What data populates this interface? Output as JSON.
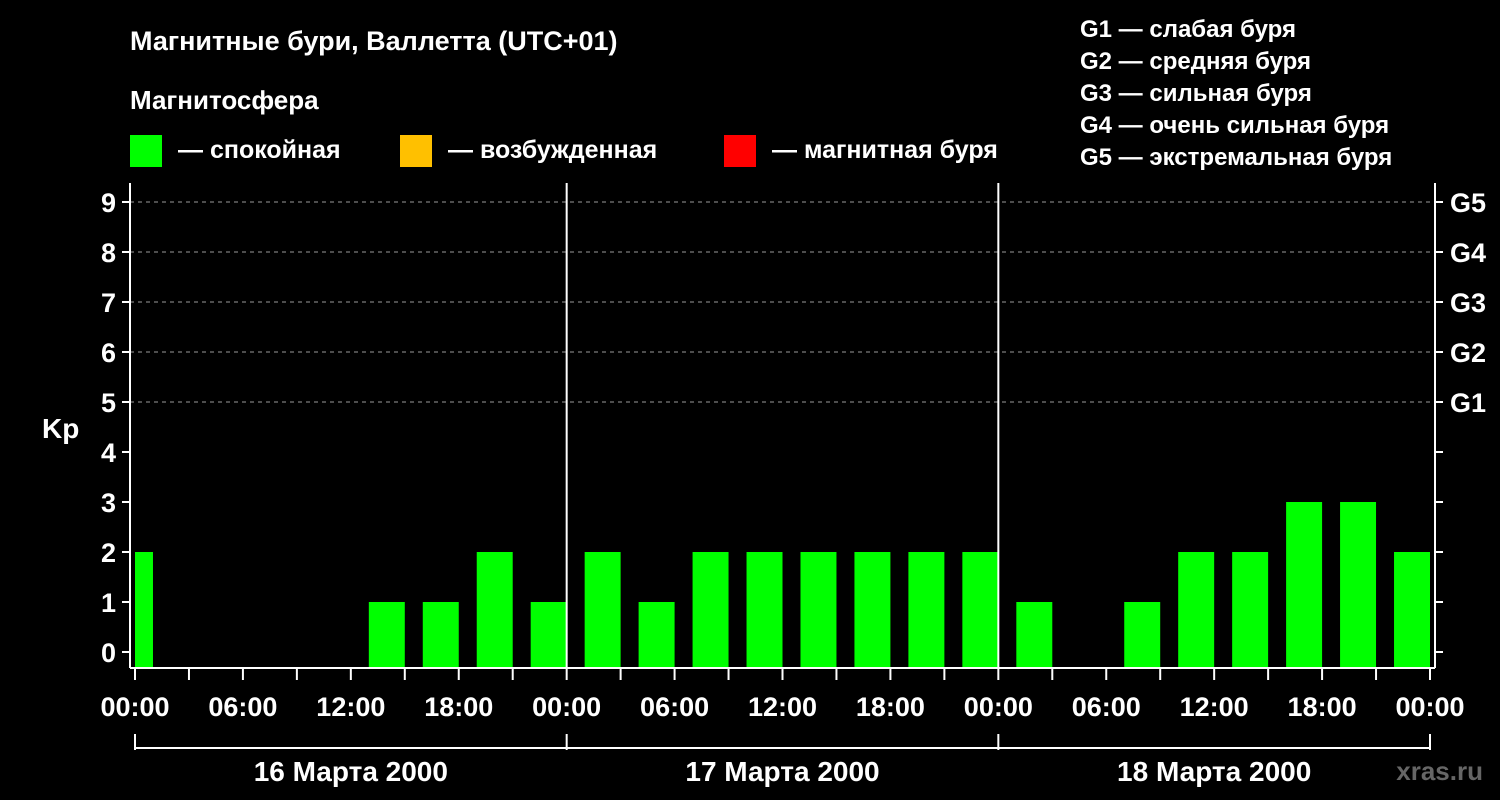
{
  "header": {
    "title": "Магнитные бури, Валлетта (UTC+01)",
    "legend_heading": "Магнитосфера",
    "legend": [
      {
        "label": "— спокойная",
        "color": "#00ff00"
      },
      {
        "label": "— возбужденная",
        "color": "#ffc000"
      },
      {
        "label": "— магнитная буря",
        "color": "#ff0000"
      }
    ],
    "storm_levels": [
      "G1 — слабая буря",
      "G2 — средняя буря",
      "G3 — сильная буря",
      "G4 — очень сильная буря",
      "G5 — экстремальная буря"
    ],
    "watermark": "xras.ru"
  },
  "chart_data": {
    "type": "bar",
    "ylabel": "Kp",
    "ylim": [
      0,
      9
    ],
    "yticks": [
      "0",
      "1",
      "2",
      "3",
      "4",
      "5",
      "6",
      "7",
      "8",
      "9"
    ],
    "right_labels": [
      {
        "kp": 5,
        "label": "G1"
      },
      {
        "kp": 6,
        "label": "G2"
      },
      {
        "kp": 7,
        "label": "G3"
      },
      {
        "kp": 8,
        "label": "G4"
      },
      {
        "kp": 9,
        "label": "G5"
      }
    ],
    "xticks": [
      "00:00",
      "06:00",
      "12:00",
      "18:00",
      "00:00",
      "06:00",
      "12:00",
      "18:00",
      "00:00",
      "06:00",
      "12:00",
      "18:00",
      "00:00"
    ],
    "days": [
      "16 Марта 2000",
      "17 Марта 2000",
      "18 Марта 2000"
    ],
    "bar_color": "#00ff00",
    "grid": "dashed at Kp 5–9",
    "series": [
      {
        "values": [
          {
            "start": 0,
            "end": 1,
            "kp": 2
          },
          {
            "start": 13,
            "end": 15,
            "kp": 1
          },
          {
            "start": 16,
            "end": 18,
            "kp": 1
          },
          {
            "start": 19,
            "end": 21,
            "kp": 2
          },
          {
            "start": 22,
            "end": 24,
            "kp": 1
          },
          {
            "start": 25,
            "end": 27,
            "kp": 2
          },
          {
            "start": 28,
            "end": 30,
            "kp": 1
          },
          {
            "start": 31,
            "end": 33,
            "kp": 2
          },
          {
            "start": 34,
            "end": 36,
            "kp": 2
          },
          {
            "start": 37,
            "end": 39,
            "kp": 2
          },
          {
            "start": 40,
            "end": 42,
            "kp": 2
          },
          {
            "start": 43,
            "end": 45,
            "kp": 2
          },
          {
            "start": 46,
            "end": 48,
            "kp": 2
          },
          {
            "start": 49,
            "end": 51,
            "kp": 1
          },
          {
            "start": 55,
            "end": 57,
            "kp": 1
          },
          {
            "start": 58,
            "end": 60,
            "kp": 2
          },
          {
            "start": 61,
            "end": 63,
            "kp": 2
          },
          {
            "start": 64,
            "end": 66,
            "kp": 3
          },
          {
            "start": 67,
            "end": 69,
            "kp": 3
          },
          {
            "start": 70,
            "end": 72,
            "kp": 2
          }
        ]
      }
    ]
  }
}
